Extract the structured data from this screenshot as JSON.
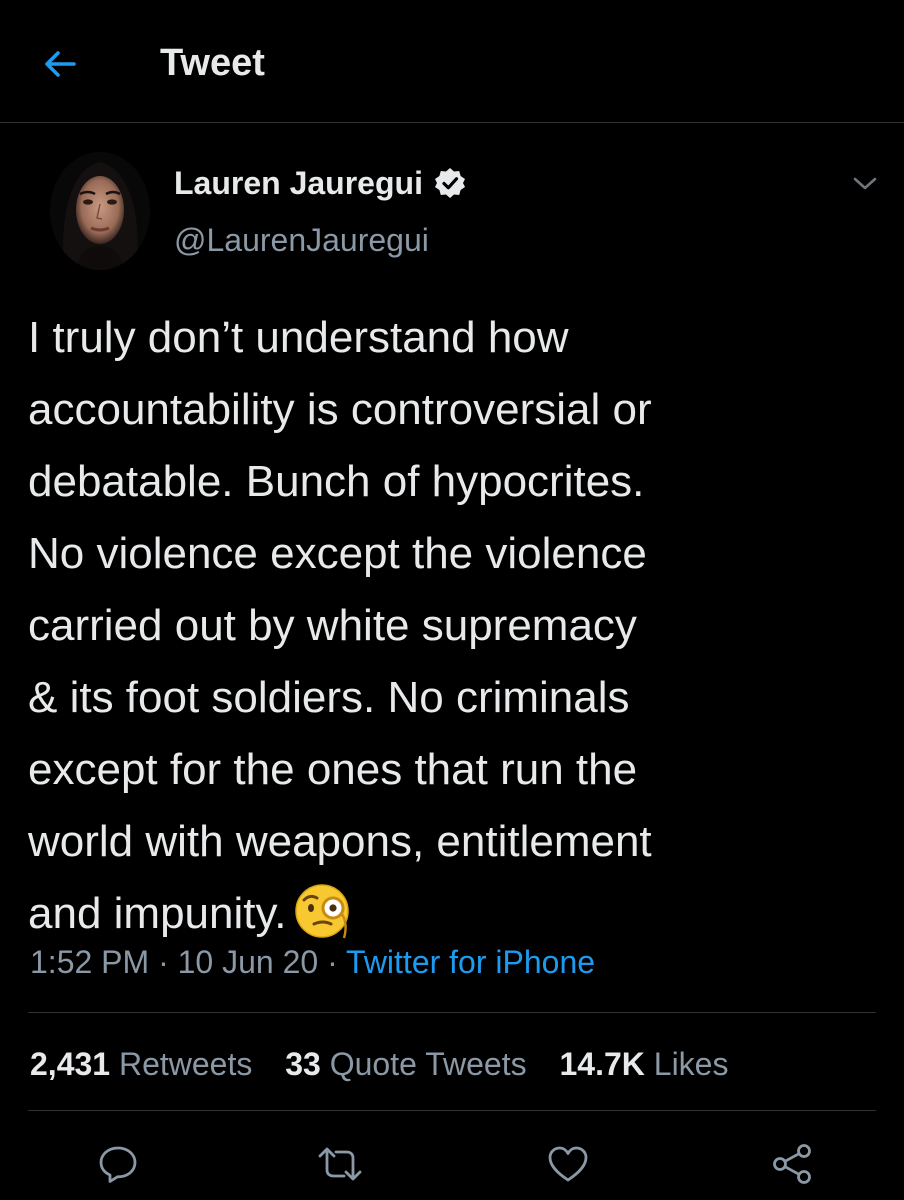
{
  "header": {
    "title": "Tweet",
    "back_icon": "arrow-left-icon",
    "accent": "#1d9bf0"
  },
  "author": {
    "display_name": "Lauren Jauregui",
    "handle": "@LaurenJauregui",
    "verified": true,
    "avatar": "profile-photo"
  },
  "tweet": {
    "text": "I truly don’t understand how\naccountability is controversial or\ndebatable. Bunch of hypocrites.\nNo violence except the violence\ncarried out by white supremacy\n& its foot soldiers. No criminals\nexcept for the ones that run the\nworld with weapons, entitlement\nand impunity.",
    "emoji": "face-with-monocle-icon",
    "time": "1:52 PM",
    "date": "10 Jun 20",
    "source": "Twitter for iPhone"
  },
  "stats": {
    "retweets_count": "2,431",
    "retweets_label": "Retweets",
    "quotes_count": "33",
    "quotes_label": "Quote Tweets",
    "likes_count": "14.7K",
    "likes_label": "Likes"
  },
  "actions": [
    "reply-icon",
    "retweet-icon",
    "like-icon",
    "share-icon"
  ],
  "colors": {
    "background": "#000000",
    "text": "#e7e9ea",
    "secondary": "#8b98a5",
    "divider": "#2f3336",
    "link": "#1d9bf0"
  }
}
